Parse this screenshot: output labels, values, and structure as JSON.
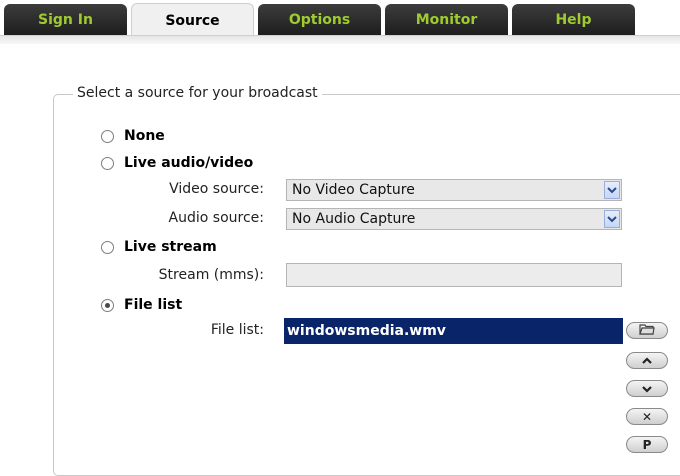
{
  "tabs": [
    {
      "label": "Sign In"
    },
    {
      "label": "Source"
    },
    {
      "label": "Options"
    },
    {
      "label": "Monitor"
    },
    {
      "label": "Help"
    }
  ],
  "active_tab": "Source",
  "source_group": {
    "title": "Select a source for your broadcast",
    "options": {
      "none": {
        "label": "None",
        "checked": false
      },
      "live_av": {
        "label": "Live audio/video",
        "checked": false
      },
      "live_stream": {
        "label": "Live stream",
        "checked": false
      },
      "file_list": {
        "label": "File list",
        "checked": true
      }
    },
    "video_source": {
      "label": "Video source:",
      "value": "No Video Capture"
    },
    "audio_source": {
      "label": "Audio source:",
      "value": "No Audio Capture"
    },
    "stream": {
      "label": "Stream (mms):",
      "value": ""
    },
    "file_list": {
      "label": "File list:",
      "items": [
        "windowsmedia.wmv"
      ]
    },
    "buttons": {
      "remove": "✕",
      "properties": "P"
    }
  },
  "icons": {
    "browse": "folder-icon",
    "up": "chevron-up-icon",
    "down": "chevron-down-icon",
    "remove": "close-icon"
  }
}
